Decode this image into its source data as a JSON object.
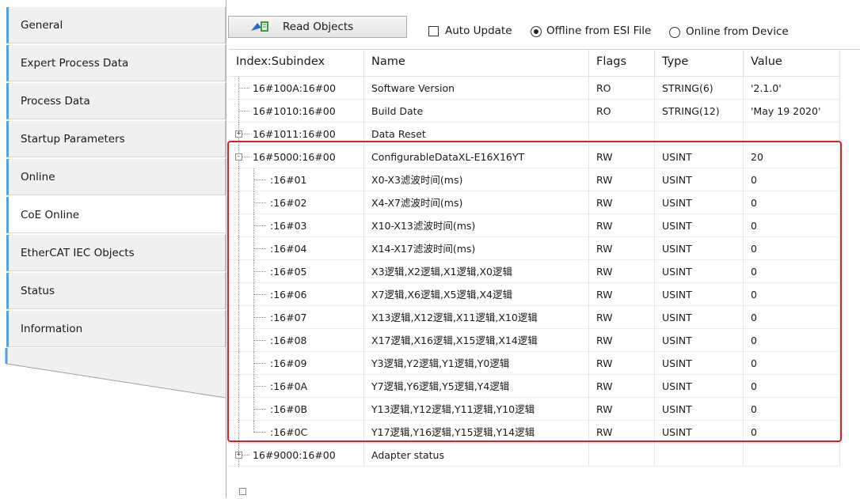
{
  "sidebar": {
    "tabs": [
      {
        "label": "General"
      },
      {
        "label": "Expert Process Data"
      },
      {
        "label": "Process Data"
      },
      {
        "label": "Startup Parameters"
      },
      {
        "label": "Online"
      },
      {
        "label": "CoE Online",
        "active": true
      },
      {
        "label": "EtherCAT IEC Objects"
      },
      {
        "label": "Status"
      },
      {
        "label": "Information"
      }
    ]
  },
  "toolbar": {
    "read_objects_label": "Read Objects",
    "auto_update_label": "Auto Update",
    "auto_update_checked": false,
    "offline_label": "Offline from ESI File",
    "offline_selected": true,
    "online_label": "Online from Device",
    "online_selected": false
  },
  "table": {
    "columns": [
      "Index:Subindex",
      "Name",
      "Flags",
      "Type",
      "Value"
    ],
    "rows": [
      {
        "index": "16#100A:16#00",
        "name": "Software Version",
        "flags": "RO",
        "type": "STRING(6)",
        "value": "'2.1.0'",
        "level": 0,
        "expander": ""
      },
      {
        "index": "16#1010:16#00",
        "name": "Build Date",
        "flags": "RO",
        "type": "STRING(12)",
        "value": "'May 19 2020'",
        "level": 0,
        "expander": ""
      },
      {
        "index": "16#1011:16#00",
        "name": "Data Reset",
        "flags": "",
        "type": "",
        "value": "",
        "level": 0,
        "expander": "+"
      },
      {
        "index": "16#5000:16#00",
        "name": "ConfigurableDataXL-E16X16YT",
        "flags": "RW",
        "type": "USINT",
        "value": "20",
        "level": 0,
        "expander": "-"
      },
      {
        "index": ":16#01",
        "name": "X0-X3滤波时间(ms)",
        "flags": "RW",
        "type": "USINT",
        "value": "0",
        "level": 1,
        "expander": ""
      },
      {
        "index": ":16#02",
        "name": "X4-X7滤波时间(ms)",
        "flags": "RW",
        "type": "USINT",
        "value": "0",
        "level": 1,
        "expander": ""
      },
      {
        "index": ":16#03",
        "name": "X10-X13滤波时间(ms)",
        "flags": "RW",
        "type": "USINT",
        "value": "0",
        "level": 1,
        "expander": ""
      },
      {
        "index": ":16#04",
        "name": "X14-X17滤波时间(ms)",
        "flags": "RW",
        "type": "USINT",
        "value": "0",
        "level": 1,
        "expander": ""
      },
      {
        "index": ":16#05",
        "name": "X3逻辑,X2逻辑,X1逻辑,X0逻辑",
        "flags": "RW",
        "type": "USINT",
        "value": "0",
        "level": 1,
        "expander": ""
      },
      {
        "index": ":16#06",
        "name": "X7逻辑,X6逻辑,X5逻辑,X4逻辑",
        "flags": "RW",
        "type": "USINT",
        "value": "0",
        "level": 1,
        "expander": ""
      },
      {
        "index": ":16#07",
        "name": "X13逻辑,X12逻辑,X11逻辑,X10逻辑",
        "flags": "RW",
        "type": "USINT",
        "value": "0",
        "level": 1,
        "expander": ""
      },
      {
        "index": ":16#08",
        "name": "X17逻辑,X16逻辑,X15逻辑,X14逻辑",
        "flags": "RW",
        "type": "USINT",
        "value": "0",
        "level": 1,
        "expander": ""
      },
      {
        "index": ":16#09",
        "name": "Y3逻辑,Y2逻辑,Y1逻辑,Y0逻辑",
        "flags": "RW",
        "type": "USINT",
        "value": "0",
        "level": 1,
        "expander": ""
      },
      {
        "index": ":16#0A",
        "name": "Y7逻辑,Y6逻辑,Y5逻辑,Y4逻辑",
        "flags": "RW",
        "type": "USINT",
        "value": "0",
        "level": 1,
        "expander": ""
      },
      {
        "index": ":16#0B",
        "name": "Y13逻辑,Y12逻辑,Y11逻辑,Y10逻辑",
        "flags": "RW",
        "type": "USINT",
        "value": "0",
        "level": 1,
        "expander": ""
      },
      {
        "index": ":16#0C",
        "name": "Y17逻辑,Y16逻辑,Y15逻辑,Y14逻辑",
        "flags": "RW",
        "type": "USINT",
        "value": "0",
        "level": 1,
        "expander": ""
      },
      {
        "index": "16#9000:16#00",
        "name": "Adapter status",
        "flags": "",
        "type": "",
        "value": "",
        "level": 0,
        "expander": "+"
      }
    ]
  },
  "colors": {
    "highlight": "#e02020",
    "tab_accent": "#55a1e0",
    "tab_background": "#f0f0f0"
  }
}
